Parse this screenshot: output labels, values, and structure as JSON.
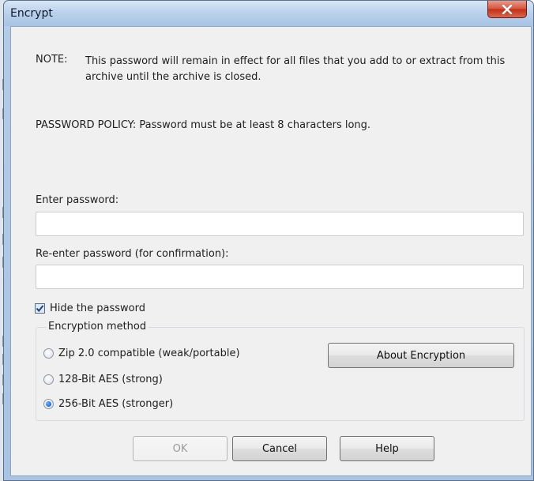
{
  "window": {
    "title": "Encrypt",
    "close_icon": "close-icon"
  },
  "note": {
    "label": "NOTE:",
    "text": "This password will remain in effect for all files that you add to or extract from this archive until the archive is closed."
  },
  "policy": "PASSWORD POLICY: Password must be at least 8 characters long.",
  "password": {
    "label": "Enter password:",
    "value": ""
  },
  "confirm": {
    "label": "Re-enter password (for confirmation):",
    "value": ""
  },
  "hide_password": {
    "label": "Hide the password",
    "checked": true
  },
  "encryption": {
    "legend": "Encryption method",
    "options": [
      {
        "label": "Zip 2.0 compatible (weak/portable)",
        "selected": false
      },
      {
        "label": "128-Bit AES (strong)",
        "selected": false
      },
      {
        "label": "256-Bit AES (stronger)",
        "selected": true
      }
    ],
    "about_label": "About Encryption"
  },
  "buttons": {
    "ok": "OK",
    "cancel": "Cancel",
    "help": "Help"
  },
  "colors": {
    "title_bar": "#bcd2ec",
    "close_button": "#c22f16",
    "dialog_background": "#f0f0f0",
    "radio_selected": "#1a5fc4"
  }
}
